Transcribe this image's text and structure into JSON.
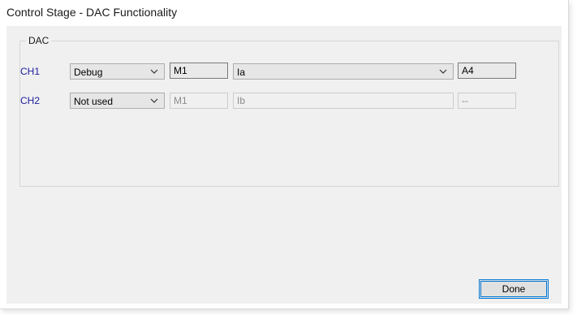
{
  "window": {
    "title": "Control Stage - DAC Functionality"
  },
  "group": {
    "label": "DAC"
  },
  "channels": [
    {
      "label": "CH1",
      "mode": "Debug",
      "motor": "M1",
      "signal": "Ia",
      "output": "A4",
      "enabled": true
    },
    {
      "label": "CH2",
      "mode": "Not used",
      "motor": "M1",
      "signal": "Ib",
      "output": "--",
      "enabled": false
    }
  ],
  "buttons": {
    "done_label": "Done"
  },
  "icons": {
    "combo_arrow": "chevron-down-icon"
  },
  "colors": {
    "channel_label": "#1a1a9e",
    "focus_border": "#0078d7",
    "dialog_background": "#f0f0f0"
  }
}
